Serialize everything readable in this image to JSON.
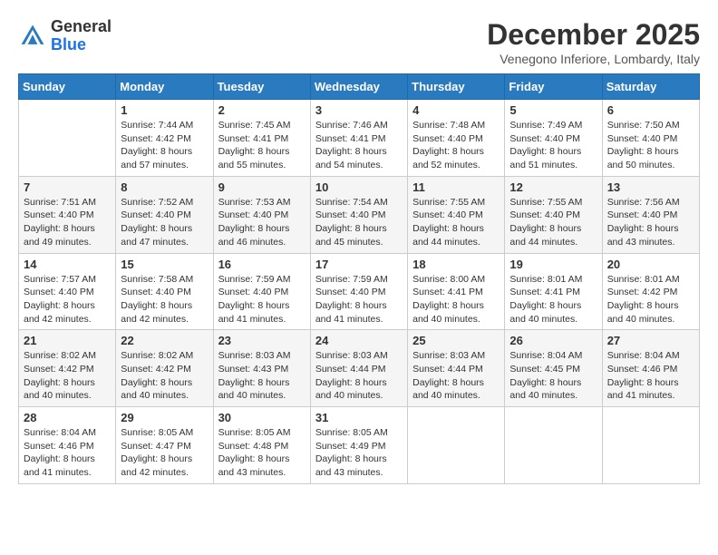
{
  "logo": {
    "general": "General",
    "blue": "Blue"
  },
  "title": "December 2025",
  "location": "Venegono Inferiore, Lombardy, Italy",
  "days_of_week": [
    "Sunday",
    "Monday",
    "Tuesday",
    "Wednesday",
    "Thursday",
    "Friday",
    "Saturday"
  ],
  "weeks": [
    [
      {
        "day": "",
        "sunrise": "",
        "sunset": "",
        "daylight": ""
      },
      {
        "day": "1",
        "sunrise": "Sunrise: 7:44 AM",
        "sunset": "Sunset: 4:42 PM",
        "daylight": "Daylight: 8 hours and 57 minutes."
      },
      {
        "day": "2",
        "sunrise": "Sunrise: 7:45 AM",
        "sunset": "Sunset: 4:41 PM",
        "daylight": "Daylight: 8 hours and 55 minutes."
      },
      {
        "day": "3",
        "sunrise": "Sunrise: 7:46 AM",
        "sunset": "Sunset: 4:41 PM",
        "daylight": "Daylight: 8 hours and 54 minutes."
      },
      {
        "day": "4",
        "sunrise": "Sunrise: 7:48 AM",
        "sunset": "Sunset: 4:40 PM",
        "daylight": "Daylight: 8 hours and 52 minutes."
      },
      {
        "day": "5",
        "sunrise": "Sunrise: 7:49 AM",
        "sunset": "Sunset: 4:40 PM",
        "daylight": "Daylight: 8 hours and 51 minutes."
      },
      {
        "day": "6",
        "sunrise": "Sunrise: 7:50 AM",
        "sunset": "Sunset: 4:40 PM",
        "daylight": "Daylight: 8 hours and 50 minutes."
      }
    ],
    [
      {
        "day": "7",
        "sunrise": "Sunrise: 7:51 AM",
        "sunset": "Sunset: 4:40 PM",
        "daylight": "Daylight: 8 hours and 49 minutes."
      },
      {
        "day": "8",
        "sunrise": "Sunrise: 7:52 AM",
        "sunset": "Sunset: 4:40 PM",
        "daylight": "Daylight: 8 hours and 47 minutes."
      },
      {
        "day": "9",
        "sunrise": "Sunrise: 7:53 AM",
        "sunset": "Sunset: 4:40 PM",
        "daylight": "Daylight: 8 hours and 46 minutes."
      },
      {
        "day": "10",
        "sunrise": "Sunrise: 7:54 AM",
        "sunset": "Sunset: 4:40 PM",
        "daylight": "Daylight: 8 hours and 45 minutes."
      },
      {
        "day": "11",
        "sunrise": "Sunrise: 7:55 AM",
        "sunset": "Sunset: 4:40 PM",
        "daylight": "Daylight: 8 hours and 44 minutes."
      },
      {
        "day": "12",
        "sunrise": "Sunrise: 7:55 AM",
        "sunset": "Sunset: 4:40 PM",
        "daylight": "Daylight: 8 hours and 44 minutes."
      },
      {
        "day": "13",
        "sunrise": "Sunrise: 7:56 AM",
        "sunset": "Sunset: 4:40 PM",
        "daylight": "Daylight: 8 hours and 43 minutes."
      }
    ],
    [
      {
        "day": "14",
        "sunrise": "Sunrise: 7:57 AM",
        "sunset": "Sunset: 4:40 PM",
        "daylight": "Daylight: 8 hours and 42 minutes."
      },
      {
        "day": "15",
        "sunrise": "Sunrise: 7:58 AM",
        "sunset": "Sunset: 4:40 PM",
        "daylight": "Daylight: 8 hours and 42 minutes."
      },
      {
        "day": "16",
        "sunrise": "Sunrise: 7:59 AM",
        "sunset": "Sunset: 4:40 PM",
        "daylight": "Daylight: 8 hours and 41 minutes."
      },
      {
        "day": "17",
        "sunrise": "Sunrise: 7:59 AM",
        "sunset": "Sunset: 4:40 PM",
        "daylight": "Daylight: 8 hours and 41 minutes."
      },
      {
        "day": "18",
        "sunrise": "Sunrise: 8:00 AM",
        "sunset": "Sunset: 4:41 PM",
        "daylight": "Daylight: 8 hours and 40 minutes."
      },
      {
        "day": "19",
        "sunrise": "Sunrise: 8:01 AM",
        "sunset": "Sunset: 4:41 PM",
        "daylight": "Daylight: 8 hours and 40 minutes."
      },
      {
        "day": "20",
        "sunrise": "Sunrise: 8:01 AM",
        "sunset": "Sunset: 4:42 PM",
        "daylight": "Daylight: 8 hours and 40 minutes."
      }
    ],
    [
      {
        "day": "21",
        "sunrise": "Sunrise: 8:02 AM",
        "sunset": "Sunset: 4:42 PM",
        "daylight": "Daylight: 8 hours and 40 minutes."
      },
      {
        "day": "22",
        "sunrise": "Sunrise: 8:02 AM",
        "sunset": "Sunset: 4:42 PM",
        "daylight": "Daylight: 8 hours and 40 minutes."
      },
      {
        "day": "23",
        "sunrise": "Sunrise: 8:03 AM",
        "sunset": "Sunset: 4:43 PM",
        "daylight": "Daylight: 8 hours and 40 minutes."
      },
      {
        "day": "24",
        "sunrise": "Sunrise: 8:03 AM",
        "sunset": "Sunset: 4:44 PM",
        "daylight": "Daylight: 8 hours and 40 minutes."
      },
      {
        "day": "25",
        "sunrise": "Sunrise: 8:03 AM",
        "sunset": "Sunset: 4:44 PM",
        "daylight": "Daylight: 8 hours and 40 minutes."
      },
      {
        "day": "26",
        "sunrise": "Sunrise: 8:04 AM",
        "sunset": "Sunset: 4:45 PM",
        "daylight": "Daylight: 8 hours and 40 minutes."
      },
      {
        "day": "27",
        "sunrise": "Sunrise: 8:04 AM",
        "sunset": "Sunset: 4:46 PM",
        "daylight": "Daylight: 8 hours and 41 minutes."
      }
    ],
    [
      {
        "day": "28",
        "sunrise": "Sunrise: 8:04 AM",
        "sunset": "Sunset: 4:46 PM",
        "daylight": "Daylight: 8 hours and 41 minutes."
      },
      {
        "day": "29",
        "sunrise": "Sunrise: 8:05 AM",
        "sunset": "Sunset: 4:47 PM",
        "daylight": "Daylight: 8 hours and 42 minutes."
      },
      {
        "day": "30",
        "sunrise": "Sunrise: 8:05 AM",
        "sunset": "Sunset: 4:48 PM",
        "daylight": "Daylight: 8 hours and 43 minutes."
      },
      {
        "day": "31",
        "sunrise": "Sunrise: 8:05 AM",
        "sunset": "Sunset: 4:49 PM",
        "daylight": "Daylight: 8 hours and 43 minutes."
      },
      {
        "day": "",
        "sunrise": "",
        "sunset": "",
        "daylight": ""
      },
      {
        "day": "",
        "sunrise": "",
        "sunset": "",
        "daylight": ""
      },
      {
        "day": "",
        "sunrise": "",
        "sunset": "",
        "daylight": ""
      }
    ]
  ]
}
